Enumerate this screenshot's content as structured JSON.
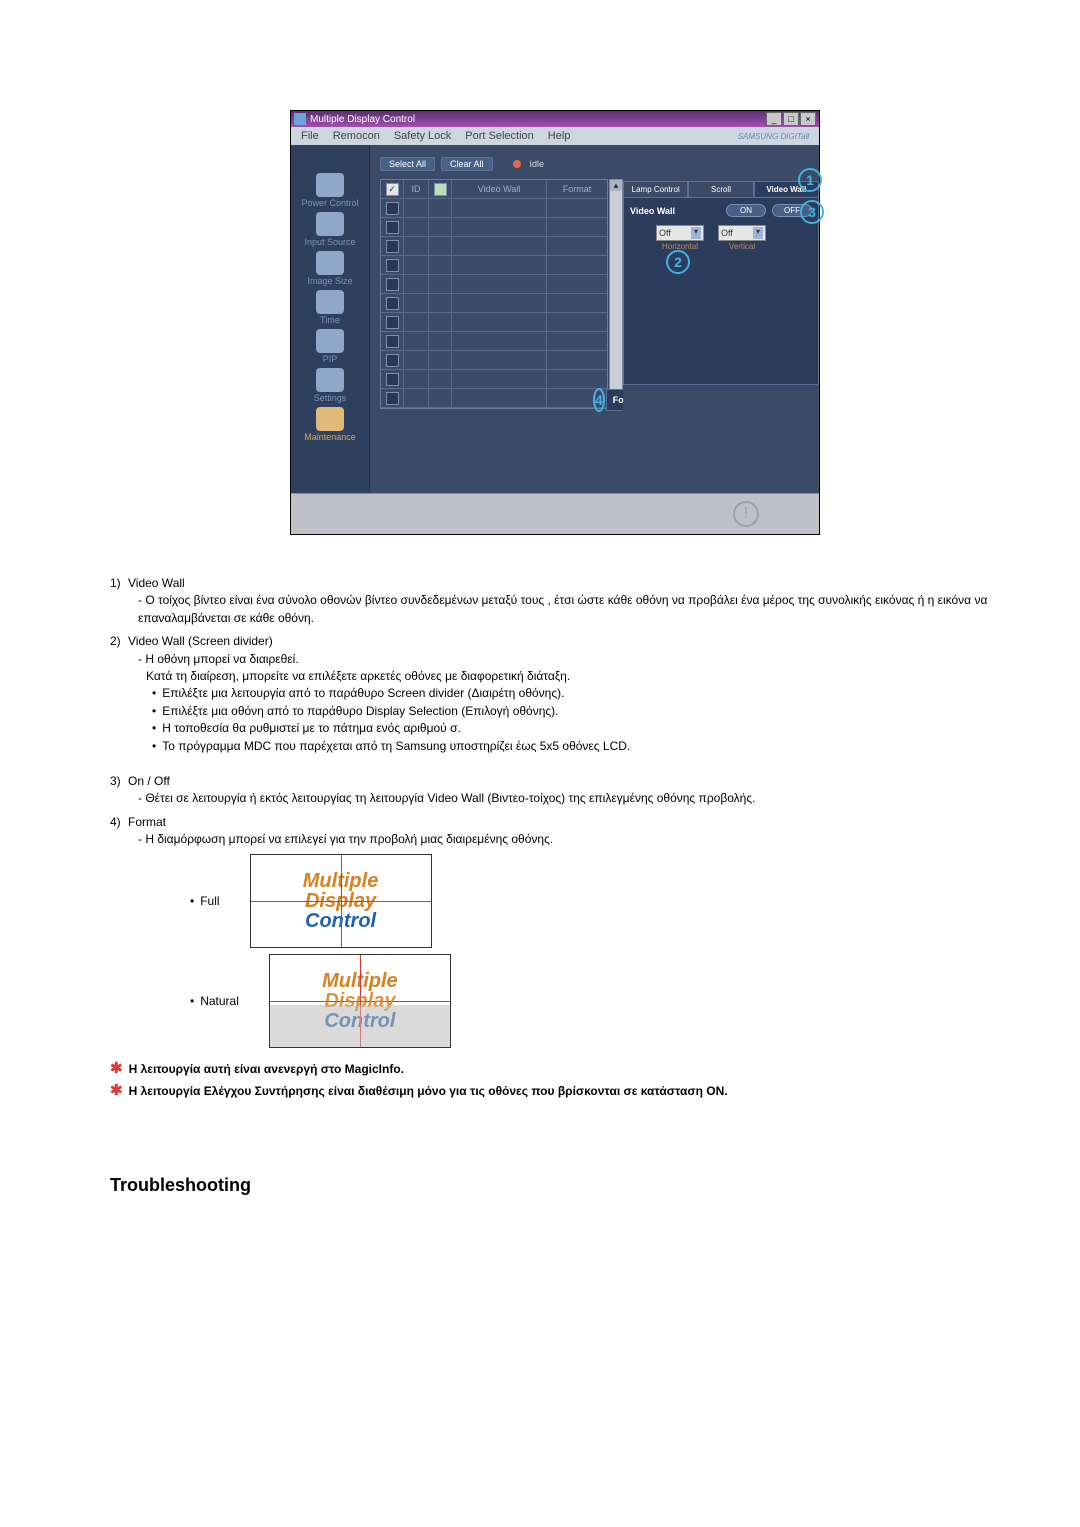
{
  "window": {
    "title": "Multiple Display Control",
    "buttons": {
      "min": "_",
      "max": "□",
      "close": "×"
    }
  },
  "menubar": {
    "items": [
      "File",
      "Remocon",
      "Safety Lock",
      "Port Selection",
      "Help"
    ],
    "brand": "SAMSUNG DIGITall"
  },
  "sidebar": {
    "items": [
      {
        "label": "Power Control"
      },
      {
        "label": "Input Source"
      },
      {
        "label": "Image Size"
      },
      {
        "label": "Time"
      },
      {
        "label": "PIP"
      },
      {
        "label": "Settings"
      },
      {
        "label": "Maintenance",
        "current": true
      }
    ]
  },
  "toolbar": {
    "select_all": "Select All",
    "clear_all": "Clear All",
    "idle": "Idle"
  },
  "grid": {
    "headers": {
      "id": "ID",
      "videowall": "Video Wall",
      "format": "Format"
    }
  },
  "right": {
    "tabs": [
      "Lamp Control",
      "Scroll",
      "Video Wall"
    ],
    "active_tab": 2,
    "videowall": {
      "label": "Video Wall",
      "on": "ON",
      "off": "OFF",
      "horizontal": {
        "value": "Off",
        "label": "Horizontal"
      },
      "vertical": {
        "value": "Off",
        "label": "Vertical"
      }
    },
    "format": {
      "label": "Format",
      "full": "Full",
      "natural": "Natural"
    }
  },
  "callouts": {
    "c1": "1",
    "c2": "2",
    "c3": "3",
    "c4": "4"
  },
  "doc": {
    "n1": "1)",
    "t1": "Video Wall",
    "t1a": "- Ο τοίχος βίντεο είναι ένα σύνολο οθονών βίντεο συνδεδεμένων μεταξύ τους , έτσι ώστε κάθε οθόνη να προβάλει ένα μέρος της συνολικής εικόνας ή η εικόνα να επαναλαμβάνεται σε κάθε οθόνη.",
    "n2": "2)",
    "t2": "Video Wall (Screen divider)",
    "t2a": "- Η οθόνη μπορεί να διαιρεθεί.",
    "t2b": "Κατά τη διαίρεση, μπορείτε να επιλέξετε αρκετές οθόνες με διαφορετική διάταξη.",
    "t2c": "Επιλέξτε μια λειτουργία από το παράθυρο Screen divider (Διαιρέτη οθόνης).",
    "t2d": "Επιλέξτε μια οθόνη από το παράθυρο Display Selection (Επιλογή οθόνης).",
    "t2e": "Η τοποθεσία θα ρυθμιστεί με το πάτημα ενός αριθμού σ.",
    "t2f": "Το πρόγραμμα MDC που παρέχεται από τη Samsung υποστηρίζει έως 5x5 οθόνες LCD.",
    "n3": "3)",
    "t3": "On / Off",
    "t3a": "- Θέτει σε λειτουργία ή εκτός λειτουργίας τη λειτουργία Video Wall (Βιντεο-τοίχος) της επιλεγμένης οθόνης προβολής.",
    "n4": "4)",
    "t4": "Format",
    "t4a": "- Η διαμόρφωση μπορεί να επιλεγεί για την προβολή μιας διαιρεμένης οθόνης.",
    "full": "Full",
    "natural": "Natural",
    "mdc": {
      "a": "Multiple",
      "b": "Display",
      "c": "Control"
    },
    "star1": "Η λειτουργία αυτή είναι ανενεργή στο MagicInfo.",
    "star2": "Η λειτουργία Ελέγχου Συντήρησης είναι διαθέσιμη μόνο για τις οθόνες που βρίσκονται σε κατάσταση ON.",
    "troubleshooting": "Troubleshooting"
  }
}
